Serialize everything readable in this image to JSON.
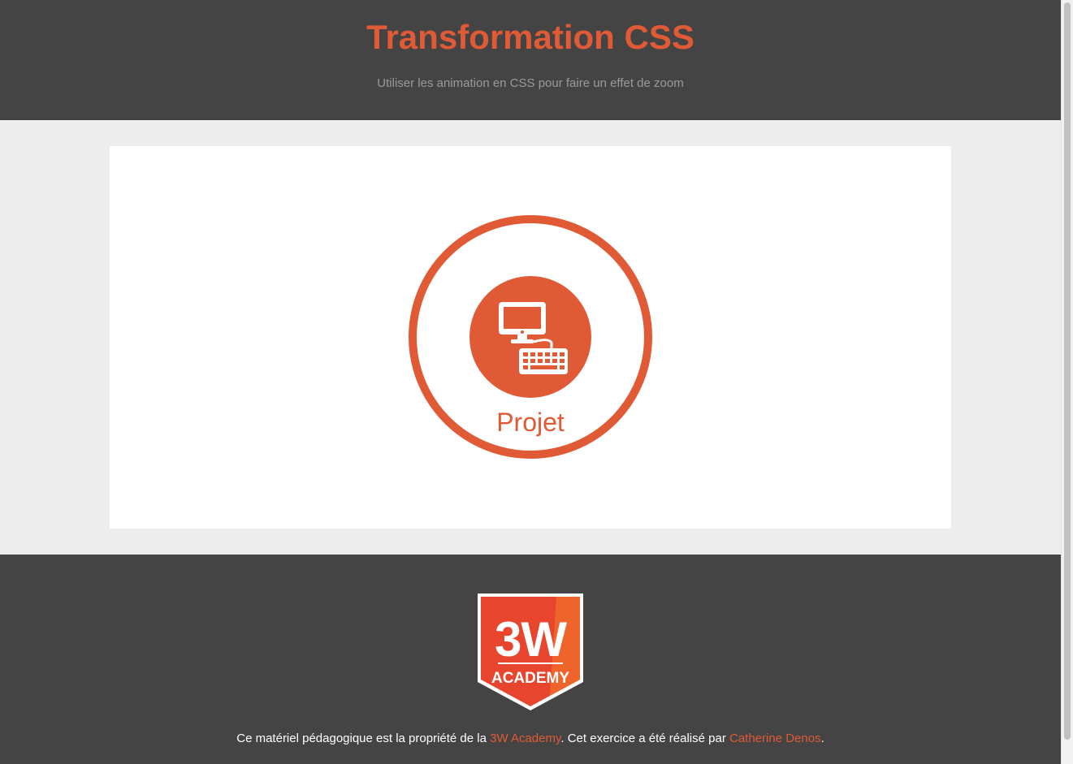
{
  "header": {
    "title": "Transformation CSS",
    "subtitle": "Utiliser les animation en CSS pour faire un effet de zoom"
  },
  "project_card": {
    "label": "Projet",
    "icon": "computer-keyboard-icon"
  },
  "footer": {
    "logo_text_top": "3W",
    "logo_text_bottom": "ACADEMY",
    "credits_prefix": "Ce matériel pédagogique est la propriété de la ",
    "academy_link": "3W Academy",
    "credits_middle": ". Cet exercice a été réalisé par ",
    "author_link": "Catherine Denos",
    "credits_suffix": "."
  },
  "colors": {
    "accent": "#e05a35",
    "header_bg": "#444444",
    "page_bg": "#ededed",
    "card_bg": "#ffffff"
  }
}
